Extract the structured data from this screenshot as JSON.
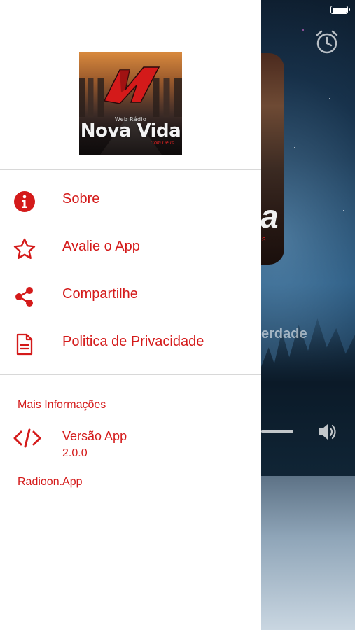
{
  "colors": {
    "accent": "#d41a1a",
    "drawer_background": "#ffffff",
    "divider": "#d8d8d8"
  },
  "logo": {
    "line1": "Web Rádio",
    "line2": "Nova Vida",
    "line3": "Com Deus"
  },
  "menu": {
    "items": [
      {
        "label": "Sobre",
        "icon": "info-circle-icon"
      },
      {
        "label": "Avalie o App",
        "icon": "star-outline-icon"
      },
      {
        "label": "Compartilhe",
        "icon": "share-icon"
      },
      {
        "label": "Politica de Privacidade",
        "icon": "document-icon"
      }
    ]
  },
  "more_info": {
    "title": "Mais Informações",
    "version_label": "Versão App",
    "version_value": "2.0.0",
    "version_icon": "code-icon",
    "footer": "Radioon.App"
  },
  "background_player": {
    "icons": [
      "alarm-clock-icon",
      "volume-icon"
    ],
    "partial_album_text": "a",
    "partial_album_subtext": "s",
    "partial_title": "erdade"
  }
}
